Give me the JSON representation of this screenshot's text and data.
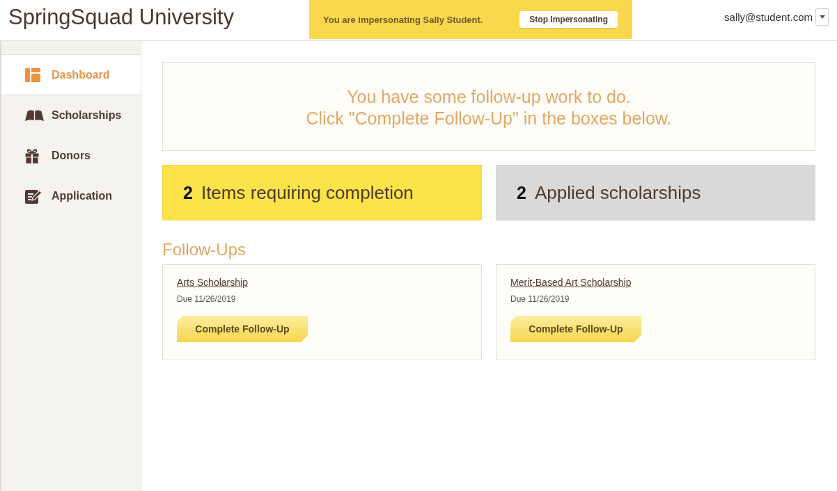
{
  "header": {
    "title": "SpringSquad University",
    "impersonation": {
      "message": "You are impersonating Sally Student.",
      "button": "Stop Impersonating"
    },
    "user": {
      "email": "sally@student.com"
    }
  },
  "sidebar": {
    "items": [
      {
        "label": "Dashboard",
        "selected": true
      },
      {
        "label": "Scholarships",
        "selected": false
      },
      {
        "label": "Donors",
        "selected": false
      },
      {
        "label": "Application",
        "selected": false
      }
    ]
  },
  "notice": {
    "lines": [
      "You have some follow-up work to do.",
      "Click \"Complete Follow-Up\" in the boxes below."
    ]
  },
  "stats": [
    {
      "count": "2",
      "label": "Items requiring completion",
      "highlighted": true
    },
    {
      "count": "2",
      "label": "Applied scholarships",
      "highlighted": false
    }
  ],
  "follow_ups": {
    "heading": "Follow-Ups",
    "items": [
      {
        "title": "Arts Scholarship",
        "due": "Due 11/26/2019",
        "button": "Complete Follow-Up"
      },
      {
        "title": "Merit-Based Art Scholarship",
        "due": "Due 11/26/2019",
        "button": "Complete Follow-Up"
      }
    ]
  }
}
